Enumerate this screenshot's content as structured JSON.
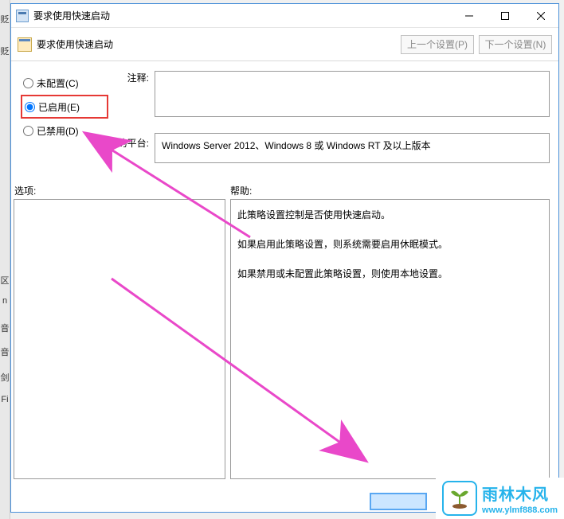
{
  "window": {
    "title": "要求使用快速启动"
  },
  "toolbar": {
    "title": "要求使用快速启动",
    "prev_label": "上一个设置(P)",
    "next_label": "下一个设置(N)"
  },
  "radios": {
    "not_configured": "未配置(C)",
    "enabled": "已启用(E)",
    "disabled": "已禁用(D)"
  },
  "labels": {
    "comment": "注释:",
    "platform": "支持的平台:",
    "options": "选项:",
    "help": "帮助:"
  },
  "platform_text": "Windows Server 2012、Windows 8 或 Windows RT 及以上版本",
  "help": {
    "p1": "此策略设置控制是否使用快速启动。",
    "p2": "如果启用此策略设置，则系统需要启用休眠模式。",
    "p3": "如果禁用或未配置此策略设置，则使用本地设置。"
  },
  "leftstrip": {
    "c1": "贬",
    "c2": "贬",
    "c3": "区",
    "c4": "n",
    "c5": "音",
    "c6": "音",
    "c7": "剑",
    "c8": "Fi"
  },
  "logo": {
    "cn": "雨林木风",
    "url": "www.ylmf888.com"
  }
}
